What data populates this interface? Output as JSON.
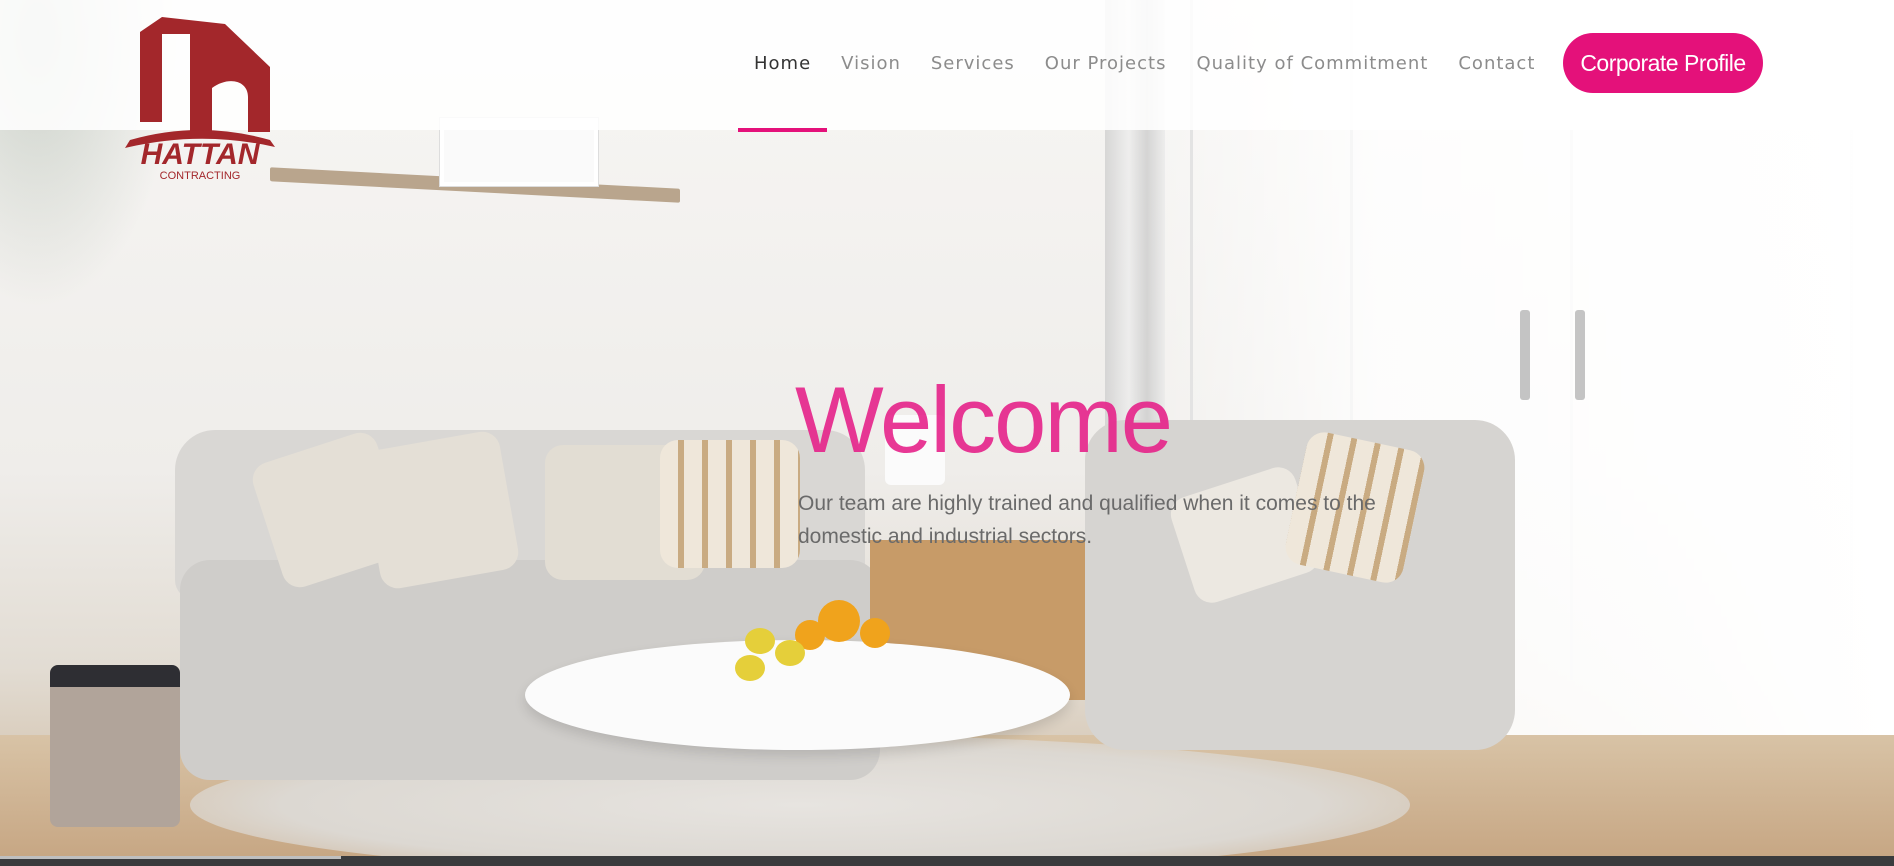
{
  "brand": {
    "name": "HATTAN",
    "subtitle": "CONTRACTING",
    "colors": {
      "logo": "#a3272b",
      "accent": "#e4117a"
    }
  },
  "nav": {
    "items": [
      {
        "label": "Home",
        "active": true
      },
      {
        "label": "Vision",
        "active": false
      },
      {
        "label": "Services",
        "active": false
      },
      {
        "label": "Our Projects",
        "active": false
      },
      {
        "label": "Quality of Commitment",
        "active": false
      },
      {
        "label": "Contact",
        "active": false
      }
    ],
    "cta_label": "Corporate Profile"
  },
  "hero": {
    "title": "Welcome",
    "tagline": "Our team are highly trained and qualified when it comes to the domestic and industrial sectors."
  },
  "slider": {
    "progress": 0.18
  }
}
